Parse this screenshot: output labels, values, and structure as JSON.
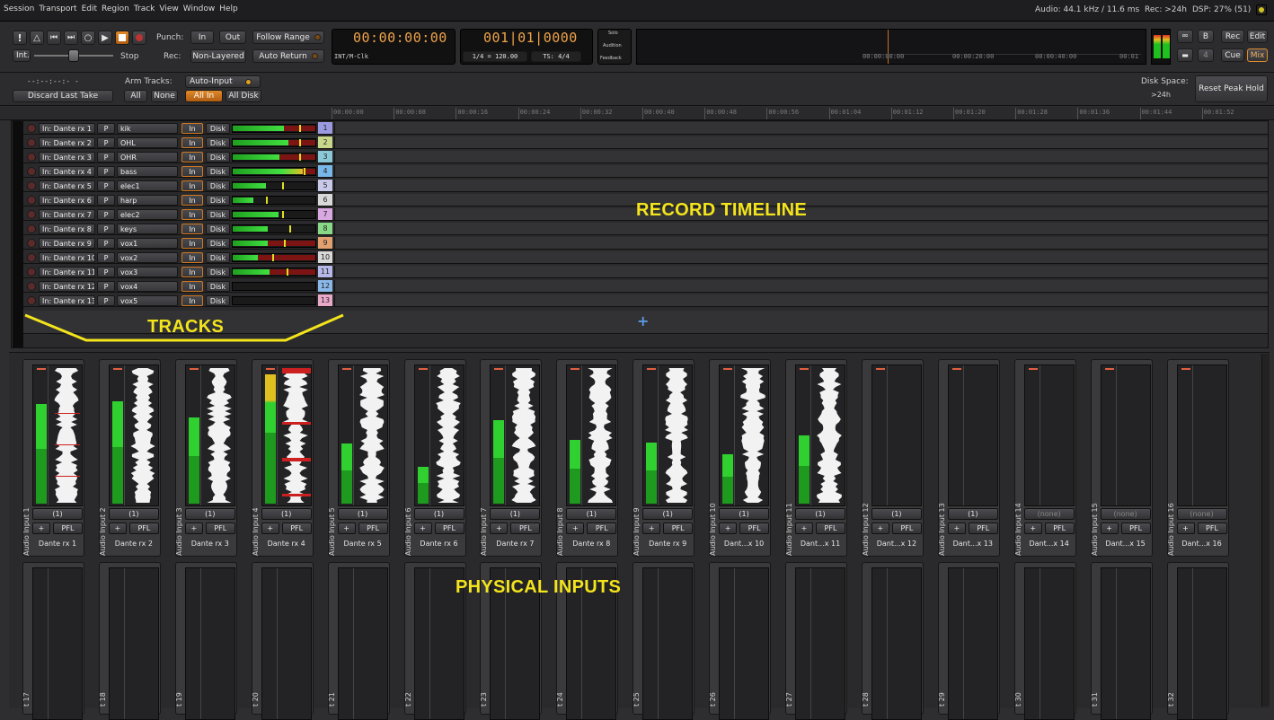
{
  "menu": [
    "Session",
    "Transport",
    "Edit",
    "Region",
    "Track",
    "View",
    "Window",
    "Help"
  ],
  "status": {
    "audio": "Audio: 44.1 kHz / 11.6 ms",
    "rec": "Rec: >24h",
    "dsp": "DSP: 27% (51)"
  },
  "toolbar": {
    "int_label": "Int.",
    "stop_label": "Stop",
    "punch_label": "Punch:",
    "punch_in": "In",
    "punch_out": "Out",
    "follow_range": "Follow Range",
    "rec_label": "Rec:",
    "non_layered": "Non-Layered",
    "auto_return": "Auto Return",
    "timecode": "00:00:00:00",
    "timecode_sub": "INT/M-Clk",
    "bbt": "001|01|0000",
    "tempo": "1/4 = 120.00",
    "ts": "TS: 4/4",
    "solo": "Solo",
    "audition": "Audition",
    "feedback": "Feedback",
    "mini_t0": "00:00:00:00",
    "mini_t1": "00:00:20:00",
    "mini_t2": "00:00:40:00",
    "mini_t3": "00:01",
    "btn_b": "B",
    "btn_rec": "Rec",
    "btn_edit": "Edit",
    "btn_4": "4",
    "btn_cue": "Cue",
    "btn_mix": "Mix"
  },
  "row2": {
    "take_time": "--:--:--:-   -",
    "discard": "Discard Last Take",
    "arm_label": "Arm Tracks:",
    "all": "All",
    "none": "None",
    "auto_input": "Auto-Input",
    "all_in": "All In",
    "all_disk": "All Disk",
    "disk_label": "Disk Space:",
    "disk_value": ">24h",
    "reset_peak": "Reset Peak Hold"
  },
  "ruler": [
    "00:00:00",
    "00:00:08",
    "00:00:16",
    "00:00:24",
    "00:00:32",
    "00:00:40",
    "00:00:48",
    "00:00:56",
    "00:01:04",
    "00:01:12",
    "00:01:20",
    "00:01:28",
    "00:01:36",
    "00:01:44",
    "00:01:52"
  ],
  "tracks": [
    {
      "input": "In: Dante rx 1",
      "p": "P",
      "name": "kik",
      "in": "In",
      "disk": "Disk",
      "num": "1",
      "color": "#9a9ae0",
      "level": 0.62,
      "peak": 0.8,
      "red": true
    },
    {
      "input": "In: Dante rx 2",
      "p": "P",
      "name": "OHL",
      "in": "In",
      "disk": "Disk",
      "num": "2",
      "color": "#c8d68a",
      "level": 0.67,
      "peak": 0.8,
      "red": true
    },
    {
      "input": "In: Dante rx 3",
      "p": "P",
      "name": "OHR",
      "in": "In",
      "disk": "Disk",
      "num": "3",
      "color": "#8ac8d8",
      "level": 0.57,
      "peak": 0.8,
      "red": true
    },
    {
      "input": "In: Dante rx 4",
      "p": "P",
      "name": "bass",
      "in": "In",
      "disk": "Disk",
      "num": "4",
      "color": "#78b8e8",
      "level": 0.85,
      "peak": 0.86,
      "red": true,
      "yellow": true
    },
    {
      "input": "In: Dante rx 5",
      "p": "P",
      "name": "elec1",
      "in": "In",
      "disk": "Disk",
      "num": "5",
      "color": "#c8c8e8",
      "level": 0.4,
      "peak": 0.6,
      "red": false
    },
    {
      "input": "In: Dante rx 6",
      "p": "P",
      "name": "harp",
      "in": "In",
      "disk": "Disk",
      "num": "6",
      "color": "#d8d8d8",
      "level": 0.25,
      "peak": 0.4,
      "red": false
    },
    {
      "input": "In: Dante rx 7",
      "p": "P",
      "name": "elec2",
      "in": "In",
      "disk": "Disk",
      "num": "7",
      "color": "#d8a8e0",
      "level": 0.55,
      "peak": 0.6,
      "red": false
    },
    {
      "input": "In: Dante rx 8",
      "p": "P",
      "name": "keys",
      "in": "In",
      "disk": "Disk",
      "num": "8",
      "color": "#88d888",
      "level": 0.42,
      "peak": 0.68,
      "red": false
    },
    {
      "input": "In: Dante rx 9",
      "p": "P",
      "name": "vox1",
      "in": "In",
      "disk": "Disk",
      "num": "9",
      "color": "#e0a070",
      "level": 0.42,
      "peak": 0.62,
      "red": true
    },
    {
      "input": "In: Dante rx 10",
      "p": "P",
      "name": "vox2",
      "in": "In",
      "disk": "Disk",
      "num": "10",
      "color": "#d8d8d8",
      "level": 0.3,
      "peak": 0.48,
      "red": true
    },
    {
      "input": "In: Dante rx 11",
      "p": "P",
      "name": "vox3",
      "in": "In",
      "disk": "Disk",
      "num": "11",
      "color": "#b8b8e8",
      "level": 0.45,
      "peak": 0.65,
      "red": true
    },
    {
      "input": "In: Dante rx 12",
      "p": "P",
      "name": "vox4",
      "in": "In",
      "disk": "Disk",
      "num": "12",
      "color": "#8ab8e8",
      "level": 0,
      "peak": 0,
      "red": false
    },
    {
      "input": "In: Dante rx 13",
      "p": "P",
      "name": "vox5",
      "in": "In",
      "disk": "Disk",
      "num": "13",
      "color": "#e8a8c8",
      "level": 0,
      "peak": 0,
      "red": false
    }
  ],
  "inputs_top": [
    {
      "name": "Audio Input 1",
      "conn": "(1)",
      "plus": "+",
      "pfl": "PFL",
      "dante": "Dante rx 1",
      "level": 0.73,
      "wave": true
    },
    {
      "name": "Audio Input 2",
      "conn": "(1)",
      "plus": "+",
      "pfl": "PFL",
      "dante": "Dante rx 2",
      "level": 0.75,
      "wave": true
    },
    {
      "name": "Audio Input 3",
      "conn": "(1)",
      "plus": "+",
      "pfl": "PFL",
      "dante": "Dante rx 3",
      "level": 0.63,
      "wave": true
    },
    {
      "name": "Audio Input 4",
      "conn": "(1)",
      "plus": "+",
      "pfl": "PFL",
      "dante": "Dante rx 4",
      "level": 0.95,
      "wave": true,
      "hot": true
    },
    {
      "name": "Audio Input 5",
      "conn": "(1)",
      "plus": "+",
      "pfl": "PFL",
      "dante": "Dante rx 5",
      "level": 0.44,
      "wave": true
    },
    {
      "name": "Audio Input 6",
      "conn": "(1)",
      "plus": "+",
      "pfl": "PFL",
      "dante": "Dante rx 6",
      "level": 0.27,
      "wave": true
    },
    {
      "name": "Audio Input 7",
      "conn": "(1)",
      "plus": "+",
      "pfl": "PFL",
      "dante": "Dante rx 7",
      "level": 0.61,
      "wave": true
    },
    {
      "name": "Audio Input 8",
      "conn": "(1)",
      "plus": "+",
      "pfl": "PFL",
      "dante": "Dante rx 8",
      "level": 0.47,
      "wave": true
    },
    {
      "name": "Audio Input 9",
      "conn": "(1)",
      "plus": "+",
      "pfl": "PFL",
      "dante": "Dante rx 9",
      "level": 0.45,
      "wave": true
    },
    {
      "name": "Audio Input 10",
      "conn": "(1)",
      "plus": "+",
      "pfl": "PFL",
      "dante": "Dant...x 10",
      "level": 0.36,
      "wave": true
    },
    {
      "name": "Audio Input 11",
      "conn": "(1)",
      "plus": "+",
      "pfl": "PFL",
      "dante": "Dant...x 11",
      "level": 0.5,
      "wave": true
    },
    {
      "name": "Audio Input 12",
      "conn": "(1)",
      "plus": "+",
      "pfl": "PFL",
      "dante": "Dant...x 12",
      "level": 0,
      "wave": false
    },
    {
      "name": "Audio Input 13",
      "conn": "(1)",
      "plus": "+",
      "pfl": "PFL",
      "dante": "Dant...x 13",
      "level": 0,
      "wave": false
    },
    {
      "name": "Audio Input 14",
      "conn": "(none)",
      "plus": "+",
      "pfl": "PFL",
      "dante": "Dant...x 14",
      "level": 0,
      "wave": false
    },
    {
      "name": "Audio Input 15",
      "conn": "(none)",
      "plus": "+",
      "pfl": "PFL",
      "dante": "Dant...x 15",
      "level": 0,
      "wave": false
    },
    {
      "name": "Audio Input 16",
      "conn": "(none)",
      "plus": "+",
      "pfl": "PFL",
      "dante": "Dant...x 16",
      "level": 0,
      "wave": false
    }
  ],
  "inputs_bottom": [
    "t 17",
    "t 18",
    "t 19",
    "t 20",
    "t 21",
    "t 22",
    "t 23",
    "t 24",
    "t 25",
    "t 26",
    "t 27",
    "t 28",
    "t 29",
    "t 30",
    "t 31",
    "t 32"
  ],
  "annotations": {
    "timeline": "RECORD TIMELINE",
    "tracks": "TRACKS",
    "physical": "PHYSICAL INPUTS"
  },
  "colors": {
    "accent": "#e08a2a",
    "meter_green": "#2ecc2e",
    "annotation": "#f3e41c"
  }
}
